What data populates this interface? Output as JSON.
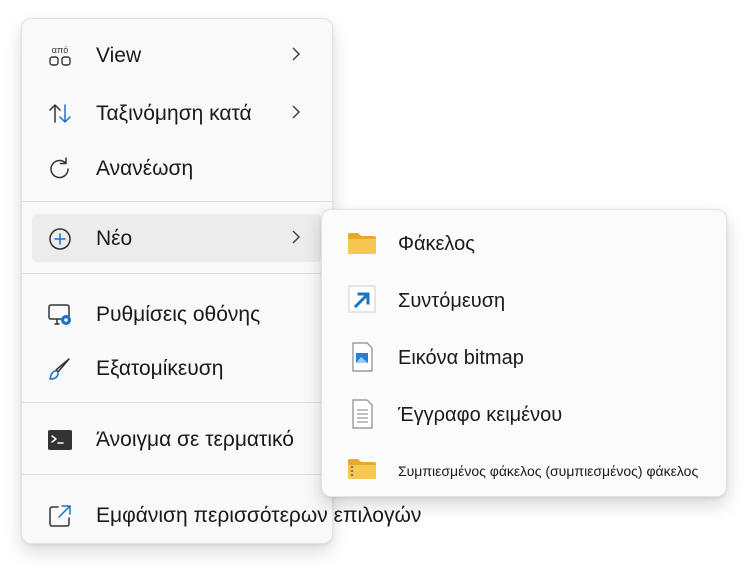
{
  "context_menu": {
    "items": [
      {
        "label": "View",
        "icon": "view-icon",
        "has_submenu": true
      },
      {
        "label": "Ταξινόμηση κατά",
        "icon": "sort-icon",
        "has_submenu": true
      },
      {
        "label": "Ανανέωση",
        "icon": "refresh-icon",
        "has_submenu": false
      },
      {
        "label": "Νέο",
        "icon": "new-plus-icon",
        "has_submenu": true,
        "hovered": true
      },
      {
        "label": "Ρυθμίσεις οθόνης",
        "icon": "display-settings-icon",
        "has_submenu": false
      },
      {
        "label": "Εξατομίκευση",
        "icon": "brush-icon",
        "has_submenu": false
      },
      {
        "label": "Άνοιγμα σε τερματικό",
        "icon": "terminal-icon",
        "has_submenu": false
      },
      {
        "label": "Εμφάνιση περισσότερων επιλογών",
        "icon": "more-options-icon",
        "has_submenu": false
      }
    ],
    "view_icon_text": "από"
  },
  "new_submenu": {
    "items": [
      {
        "label": "Φάκελος",
        "icon": "folder-icon"
      },
      {
        "label": "Συντόμευση",
        "icon": "shortcut-icon"
      },
      {
        "label": "Εικόνα bitmap",
        "icon": "bitmap-icon"
      },
      {
        "label": "Έγγραφο κειμένου",
        "icon": "text-document-icon"
      },
      {
        "label": "Συμπιεσμένος φάκελος (συμπιεσμένος) φάκελος",
        "icon": "zip-folder-icon"
      }
    ]
  },
  "colors": {
    "accent_blue": "#1a73c8",
    "folder_yellow": "#f4c04a",
    "menu_bg": "#f9f9f9",
    "hover_bg": "#ececec"
  }
}
